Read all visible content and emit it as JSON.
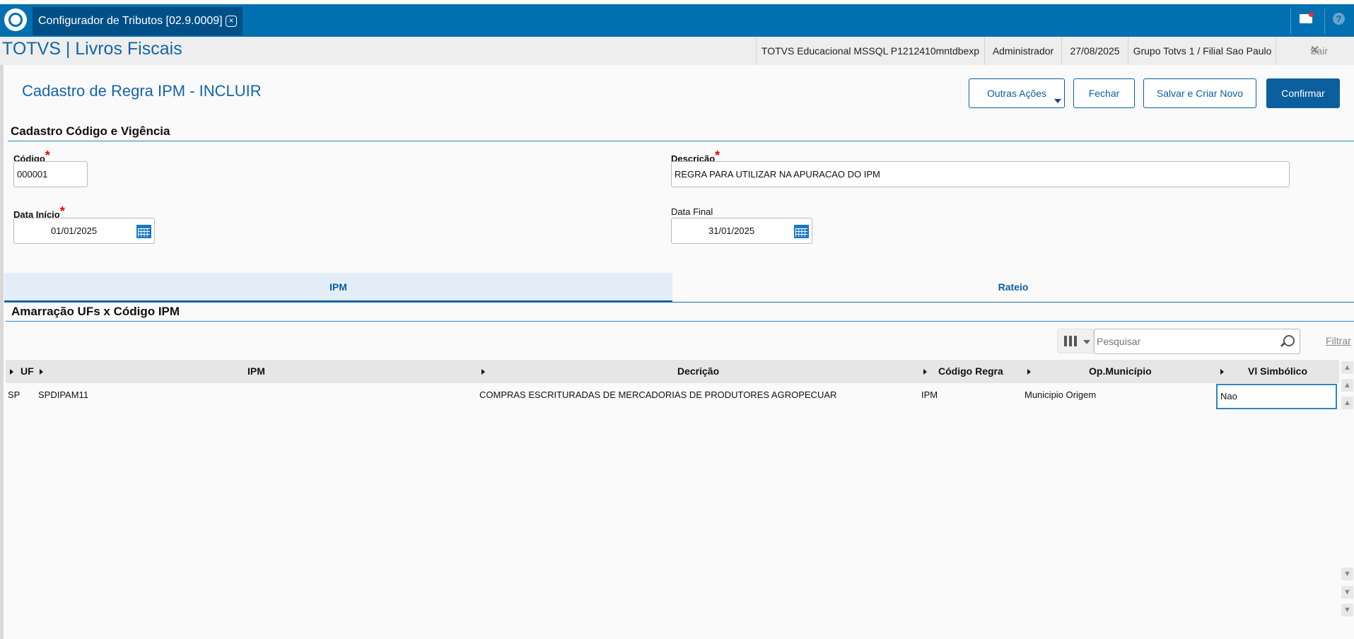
{
  "topbar": {
    "tab_title": "Configurador de Tributos [02.9.0009]",
    "icons": [
      "totvs-logo",
      "close-tab-icon",
      "mail-icon",
      "help-icon"
    ]
  },
  "header": {
    "brand": "TOTVS | Livros Fiscais",
    "environment": "TOTVS Educacional MSSQL P1212410mntdbexp",
    "user": "Administrador",
    "date": "27/08/2025",
    "branch": "Grupo Totvs 1 / Filial Sao Paulo",
    "exit_label": "Sair"
  },
  "page": {
    "title": "Cadastro de Regra IPM - INCLUIR",
    "actions": {
      "more": "Outras Ações",
      "close": "Fechar",
      "save_new": "Salvar e Criar Novo",
      "confirm": "Confirmar"
    }
  },
  "form": {
    "section_title": "Cadastro Código e Vigência",
    "codigo": {
      "label": "Código",
      "value": "000001"
    },
    "descricao": {
      "label": "Descrição",
      "value": "REGRA PARA UTILIZAR NA APURACAO DO IPM"
    },
    "data_inicio": {
      "label": "Data Início",
      "value": "01/01/2025"
    },
    "data_final": {
      "label": "Data Final",
      "value": "31/01/2025"
    },
    "required_mark": "*"
  },
  "tabs": [
    {
      "label": "IPM",
      "active": true
    },
    {
      "label": "Rateio",
      "active": false
    }
  ],
  "grid": {
    "section_title": "Amarração UFs x Código IPM",
    "search_placeholder": "Pesquisar",
    "filter_label": "Filtrar",
    "columns": [
      "UF",
      "IPM",
      "Decrição",
      "Código Regra",
      "Op.Município",
      "Vl Simbólico"
    ],
    "rows": [
      [
        "SP",
        "SPDIPAM11",
        "COMPRAS ESCRITURADAS DE MERCADORIAS DE PRODUTORES AGROPECUAR",
        "IPM",
        "Municipio Origem",
        "Nao"
      ]
    ]
  },
  "colors": {
    "topbar": "#0070b0",
    "tab_active": "#004f86",
    "accent": "#0b5f9e",
    "required": "#e00000"
  }
}
